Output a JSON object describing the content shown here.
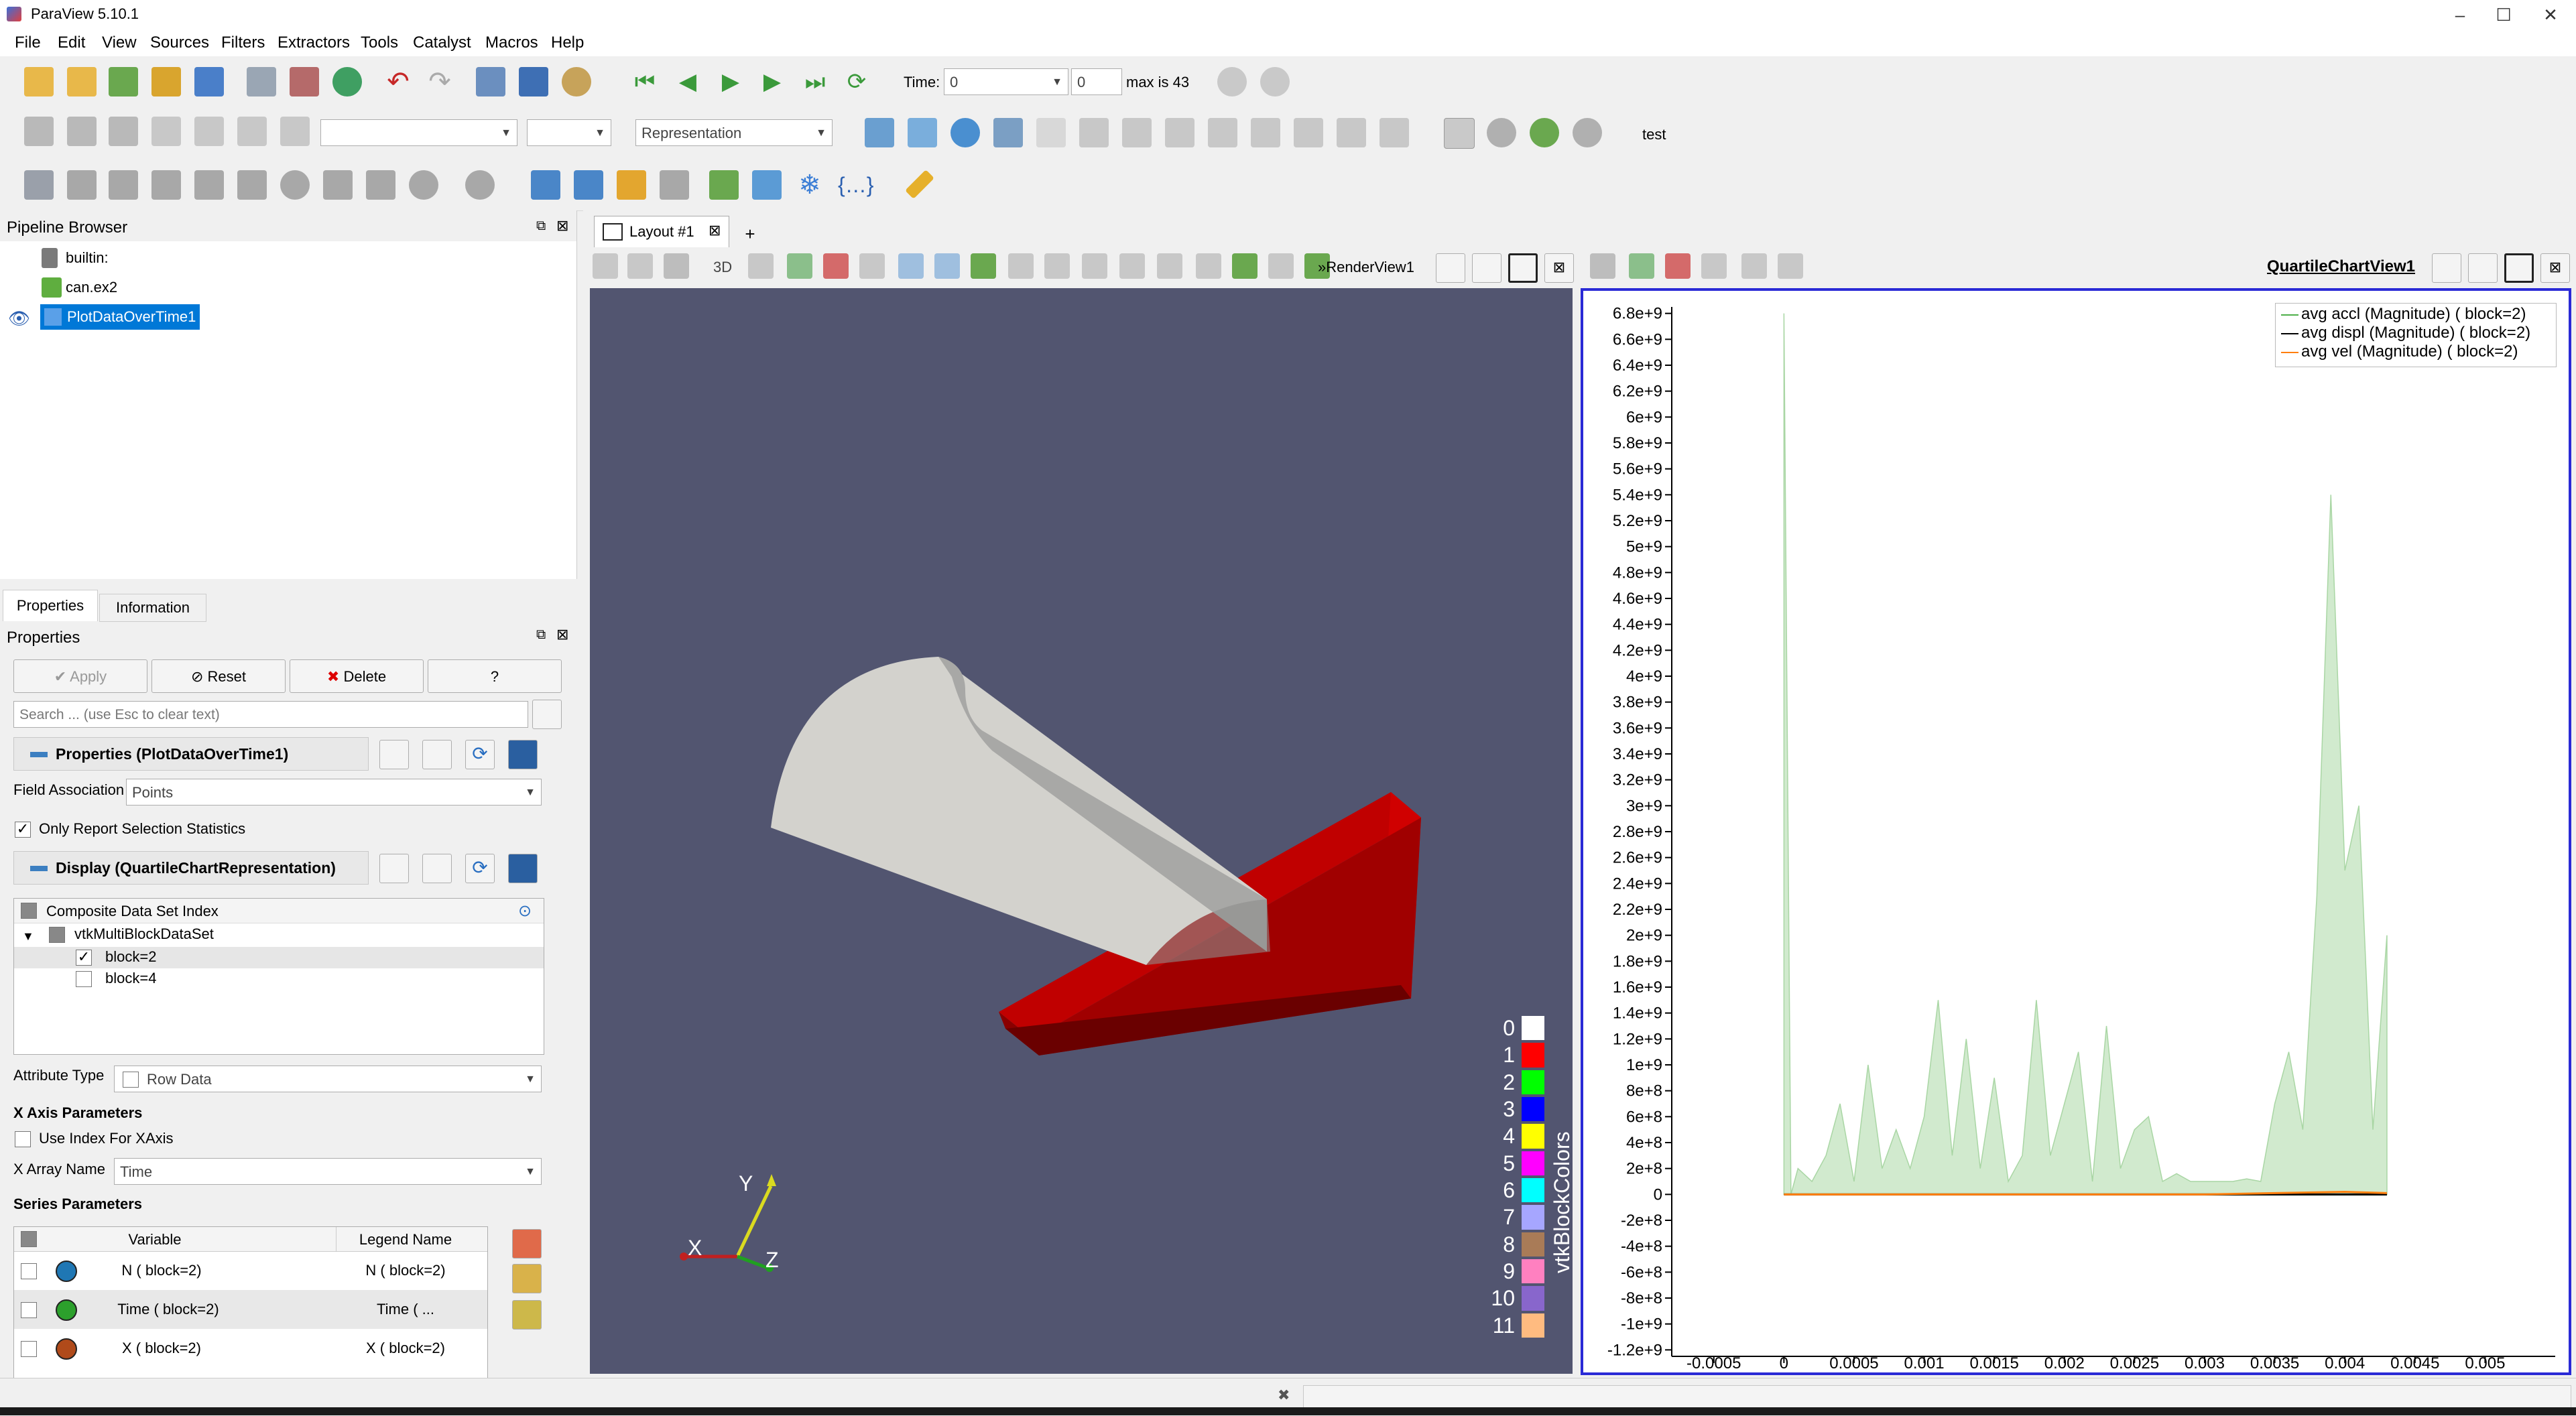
{
  "app": {
    "title": "ParaView 5.10.1"
  },
  "window_controls": [
    "–",
    "☐",
    "✕"
  ],
  "menu": [
    "File",
    "Edit",
    "View",
    "Sources",
    "Filters",
    "Extractors",
    "Tools",
    "Catalyst",
    "Macros",
    "Help"
  ],
  "time_toolbar": {
    "time_label": "Time:",
    "time_value": "0",
    "step_value": "0",
    "max_text": "max is 43"
  },
  "toolbar2": {
    "representation_placeholder": "Representation",
    "test_label": "test"
  },
  "pipeline": {
    "title": "Pipeline Browser",
    "items": [
      {
        "label": "builtin:"
      },
      {
        "label": "can.ex2"
      },
      {
        "label": "PlotDataOverTime1"
      }
    ]
  },
  "properties": {
    "tabs": [
      "Properties",
      "Information"
    ],
    "title": "Properties",
    "apply": "Apply",
    "reset": "Reset",
    "delete": "Delete",
    "help": "?",
    "search_placeholder": "Search ... (use Esc to clear text)",
    "section1": "Properties (PlotDataOverTime1)",
    "field_association_label": "Field Association",
    "field_association_value": "Points",
    "only_report_label": "Only Report Selection Statistics",
    "section2": "Display (QuartileChartRepresentation)",
    "composite_header": "Composite Data Set Index",
    "tree_root": "vtkMultiBlockDataSet",
    "blocks": [
      "block=2",
      "block=4"
    ],
    "attribute_type_label": "Attribute Type",
    "attribute_type_value": "Row Data",
    "x_axis_params": "X Axis Parameters",
    "use_index_label": "Use Index For XAxis",
    "x_array_label": "X Array Name",
    "x_array_value": "Time",
    "series_params": "Series Parameters",
    "series_headers": [
      "Variable",
      "Legend Name"
    ],
    "series_rows": [
      {
        "variable": "N ( block=2)",
        "legend": "N ( block=2)",
        "color": "#1f77b4"
      },
      {
        "variable": "Time ( block=2)",
        "legend": "Time ( ...",
        "color": "#2ca02c"
      },
      {
        "variable": "X ( block=2)",
        "legend": "X ( block=2)",
        "color": "#b04a1a"
      }
    ]
  },
  "layout": {
    "tab_label": "Layout #1",
    "add_tab": "+"
  },
  "render_view": {
    "name": "RenderView1",
    "mode_label": "3D",
    "background": "#525570",
    "axes": {
      "x": "X",
      "y": "Y",
      "z": "Z"
    },
    "colorbar_title": "vtkBlockColors",
    "colorbar": [
      {
        "label": "0",
        "color": "#ffffff"
      },
      {
        "label": "1",
        "color": "#ff0000"
      },
      {
        "label": "2",
        "color": "#00ff00"
      },
      {
        "label": "3",
        "color": "#0000ff"
      },
      {
        "label": "4",
        "color": "#ffff00"
      },
      {
        "label": "5",
        "color": "#ff00ff"
      },
      {
        "label": "6",
        "color": "#00ffff"
      },
      {
        "label": "7",
        "color": "#a6a6ff"
      },
      {
        "label": "8",
        "color": "#a97b57"
      },
      {
        "label": "9",
        "color": "#ff80c0"
      },
      {
        "label": "10",
        "color": "#8866cc"
      },
      {
        "label": "11",
        "color": "#ffbb80"
      }
    ]
  },
  "chart_view": {
    "name": "QuartileChartView1"
  },
  "chart_data": {
    "type": "area",
    "title": "",
    "xlabel": "",
    "ylabel": "",
    "xlim": [
      -0.0008,
      0.0055
    ],
    "ylim": [
      -1250000000.0,
      6850000000.0
    ],
    "x_ticks": [
      "-0.0005",
      "0",
      "0.0005",
      "0.001",
      "0.0015",
      "0.002",
      "0.0025",
      "0.003",
      "0.0035",
      "0.004",
      "0.0045",
      "0.005"
    ],
    "x_tick_values": [
      -0.0005,
      0,
      0.0005,
      0.001,
      0.0015,
      0.002,
      0.0025,
      0.003,
      0.0035,
      0.004,
      0.0045,
      0.005
    ],
    "y_ticks": [
      "6.8e+9",
      "6.6e+9",
      "6.4e+9",
      "6.2e+9",
      "6e+9",
      "5.8e+9",
      "5.6e+9",
      "5.4e+9",
      "5.2e+9",
      "5e+9",
      "4.8e+9",
      "4.6e+9",
      "4.4e+9",
      "4.2e+9",
      "4e+9",
      "3.8e+9",
      "3.6e+9",
      "3.4e+9",
      "3.2e+9",
      "3e+9",
      "2.8e+9",
      "2.6e+9",
      "2.4e+9",
      "2.2e+9",
      "2e+9",
      "1.8e+9",
      "1.6e+9",
      "1.4e+9",
      "1.2e+9",
      "1e+9",
      "8e+8",
      "6e+8",
      "4e+8",
      "2e+8",
      "0",
      "-2e+8",
      "-4e+8",
      "-6e+8",
      "-8e+8",
      "-1e+9",
      "-1.2e+9"
    ],
    "y_tick_values": [
      6800000000.0,
      6600000000.0,
      6400000000.0,
      6200000000.0,
      6000000000.0,
      5800000000.0,
      5600000000.0,
      5400000000.0,
      5200000000.0,
      5000000000.0,
      4800000000.0,
      4600000000.0,
      4400000000.0,
      4200000000.0,
      4000000000.0,
      3800000000.0,
      3600000000.0,
      3400000000.0,
      3200000000.0,
      3000000000.0,
      2800000000.0,
      2600000000.0,
      2400000000.0,
      2200000000.0,
      2000000000.0,
      1800000000.0,
      1600000000.0,
      1400000000.0,
      1200000000.0,
      1000000000.0,
      800000000.0,
      600000000.0,
      400000000.0,
      200000000.0,
      0,
      -200000000.0,
      -400000000.0,
      -600000000.0,
      -800000000.0,
      -1000000000.0,
      -1200000000.0
    ],
    "legend_position": "top-right",
    "series": [
      {
        "name": "avg accl (Magnitude) ( block=2)",
        "color": "#4daf4a",
        "x": [
          0,
          5e-05,
          0.0001,
          0.0002,
          0.0003,
          0.0004,
          0.0005,
          0.0006,
          0.0007,
          0.0008,
          0.0009,
          0.001,
          0.0011,
          0.0012,
          0.0013,
          0.0014,
          0.0015,
          0.0016,
          0.0017,
          0.0018,
          0.0019,
          0.002,
          0.0021,
          0.0022,
          0.0023,
          0.0024,
          0.0025,
          0.0026,
          0.0027,
          0.0028,
          0.0029,
          0.003,
          0.0031,
          0.0032,
          0.0033,
          0.0034,
          0.0035,
          0.0036,
          0.0037,
          0.0038,
          0.0039,
          0.004,
          0.0041,
          0.0042,
          0.0043
        ],
        "y": [
          6800000000.0,
          0,
          200000000.0,
          100000000.0,
          300000000.0,
          700000000.0,
          100000000.0,
          1000000000.0,
          200000000.0,
          500000000.0,
          200000000.0,
          600000000.0,
          1500000000.0,
          300000000.0,
          1200000000.0,
          200000000.0,
          900000000.0,
          100000000.0,
          300000000.0,
          1500000000.0,
          300000000.0,
          700000000.0,
          1100000000.0,
          100000000.0,
          1300000000.0,
          200000000.0,
          500000000.0,
          600000000.0,
          100000000.0,
          160000000.0,
          100000000.0,
          100000000.0,
          100000000.0,
          100000000.0,
          120000000.0,
          100000000.0,
          700000000.0,
          1100000000.0,
          500000000.0,
          2300000000.0,
          5400000000.0,
          2500000000.0,
          3000000000.0,
          500000000.0,
          2000000000.0
        ]
      },
      {
        "name": "avg displ (Magnitude) ( block=2)",
        "color": "#000000",
        "x": [
          0,
          0.0043
        ],
        "y": [
          0,
          0
        ]
      },
      {
        "name": "avg vel (Magnitude) ( block=2)",
        "color": "#ff7f0e",
        "x": [
          0,
          0.001,
          0.002,
          0.003,
          0.0035,
          0.004,
          0.0043
        ],
        "y": [
          0,
          0,
          0,
          0,
          10000000.0,
          20000000.0,
          10000000.0
        ]
      }
    ]
  }
}
